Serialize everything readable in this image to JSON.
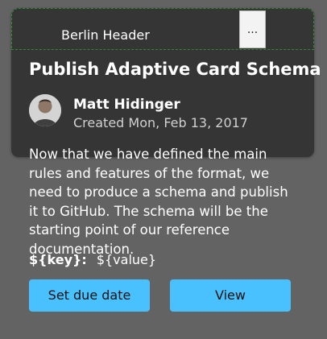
{
  "header": {
    "label": "Berlin Header",
    "more_label": "..."
  },
  "card": {
    "title": "Publish Adaptive Card Schema",
    "author": "Matt Hidinger",
    "created": "Created Mon, Feb 13, 2017",
    "description": "Now that we have defined the main rules and features of the format, we need to produce a schema and publish it to GitHub. The schema will be the starting point of our reference documentation.",
    "fact": {
      "key": "${key}:",
      "value": "${value}"
    }
  },
  "actions": {
    "due_date_label": "Set due date",
    "view_label": "View"
  },
  "colors": {
    "page_background": "#636363",
    "card_background": "#353535",
    "accent_button": "#49c1ff",
    "header_border": "#2f8a2f"
  }
}
